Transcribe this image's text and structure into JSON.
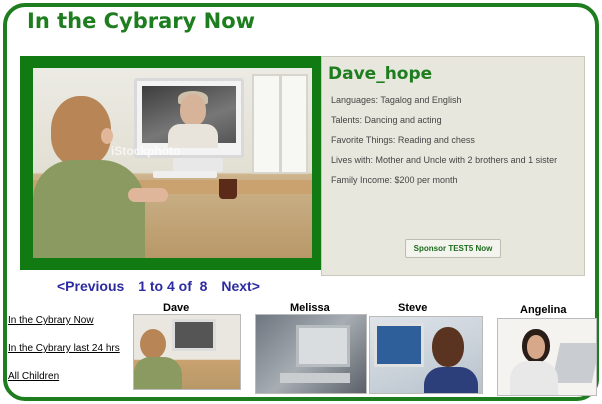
{
  "title": "In the Cybrary Now",
  "featured": {
    "watermark": "iStockphoto",
    "name": "Dave_hope",
    "details": [
      "Languages: Tagalog and English",
      "Talents: Dancing and acting",
      "Favorite Things: Reading and chess",
      "Lives with: Mother and Uncle with 2 brothers and 1 sister",
      "Family Income: $200 per month"
    ],
    "sponsor_label": "Sponsor TEST5 Now"
  },
  "pager": {
    "previous": "<Previous",
    "count": "1 to 4 of  8",
    "next": "Next>"
  },
  "side_links": [
    "In the Cybrary Now",
    "In the Cybrary last 24 hrs",
    "All Children"
  ],
  "thumbnails": [
    {
      "name": "Dave"
    },
    {
      "name": "Melissa"
    },
    {
      "name": "Steve"
    },
    {
      "name": "Angelina"
    }
  ],
  "colors": {
    "brand_green": "#1e7d1e",
    "pager_blue": "#2d2ba0",
    "panel_bg": "#e8e7dd"
  }
}
